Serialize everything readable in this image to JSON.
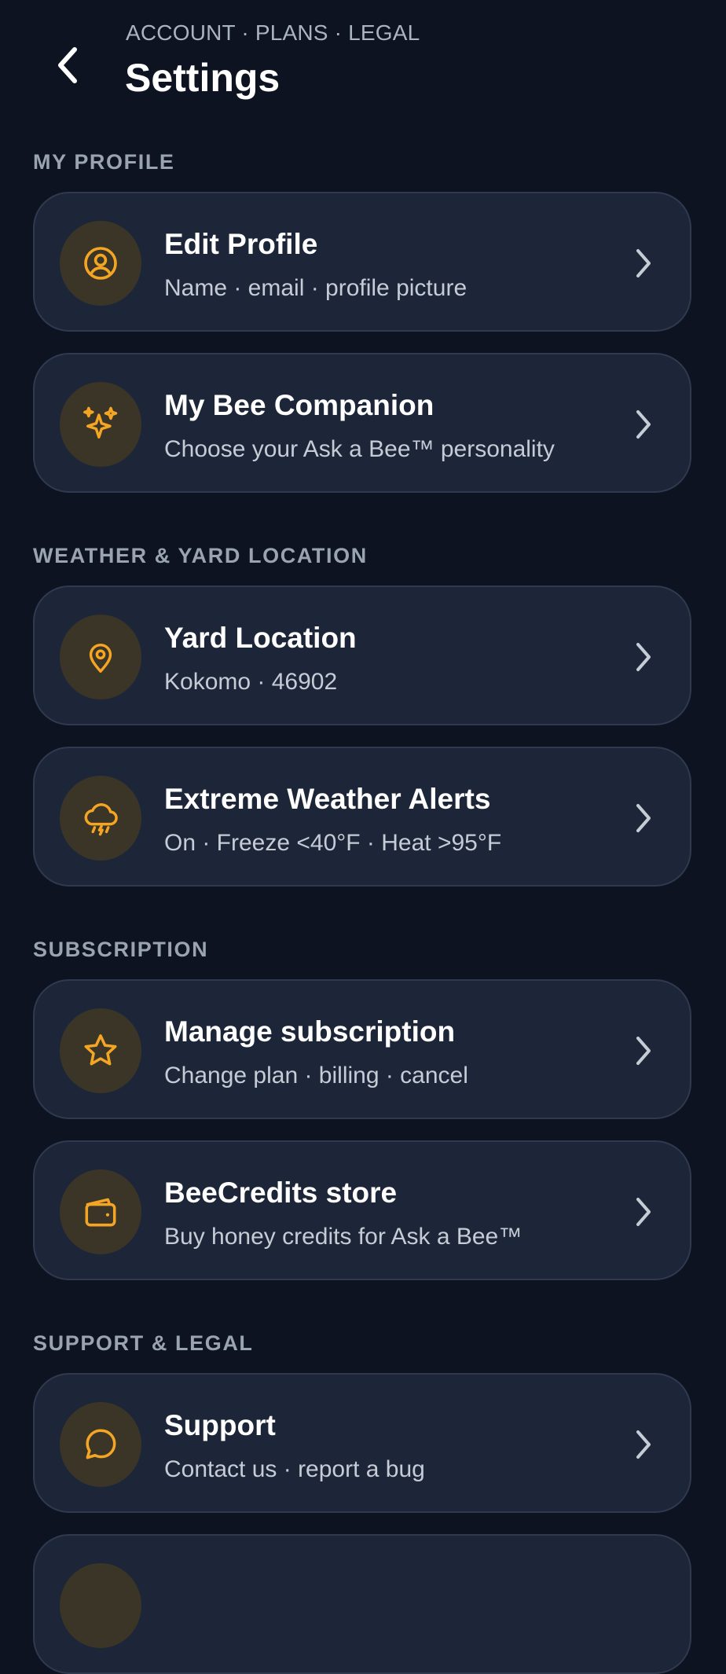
{
  "header": {
    "breadcrumb": "ACCOUNT · PLANS · LEGAL",
    "title": "Settings",
    "back_icon": "chevron-left-icon"
  },
  "sections": [
    {
      "title": "MY PROFILE",
      "items": [
        {
          "icon": "user-circle-icon",
          "title": "Edit Profile",
          "subtitle": "Name · email · profile picture"
        },
        {
          "icon": "sparkles-icon",
          "title": "My Bee Companion",
          "subtitle": "Choose your Ask a Bee™ personality"
        }
      ]
    },
    {
      "title": "WEATHER & YARD LOCATION",
      "items": [
        {
          "icon": "map-pin-icon",
          "title": "Yard Location",
          "subtitle": "Kokomo · 46902"
        },
        {
          "icon": "storm-cloud-icon",
          "title": "Extreme Weather Alerts",
          "subtitle": "On · Freeze <40°F · Heat >95°F"
        }
      ]
    },
    {
      "title": "SUBSCRIPTION",
      "items": [
        {
          "icon": "star-icon",
          "title": "Manage subscription",
          "subtitle": "Change plan · billing · cancel"
        },
        {
          "icon": "wallet-icon",
          "title": "BeeCredits store",
          "subtitle": "Buy honey credits for Ask a Bee™"
        }
      ]
    },
    {
      "title": "SUPPORT & LEGAL",
      "items": [
        {
          "icon": "chat-bubble-icon",
          "title": "Support",
          "subtitle": "Contact us · report a bug"
        },
        {
          "icon": "",
          "title": "",
          "subtitle": ""
        }
      ]
    }
  ],
  "colors": {
    "background": "#0d1320",
    "card": "#1d2638",
    "card_border": "#2f3a4f",
    "accent": "#f5a524",
    "icon_bg": "#3a3527",
    "section_text": "#9aa3b2"
  }
}
